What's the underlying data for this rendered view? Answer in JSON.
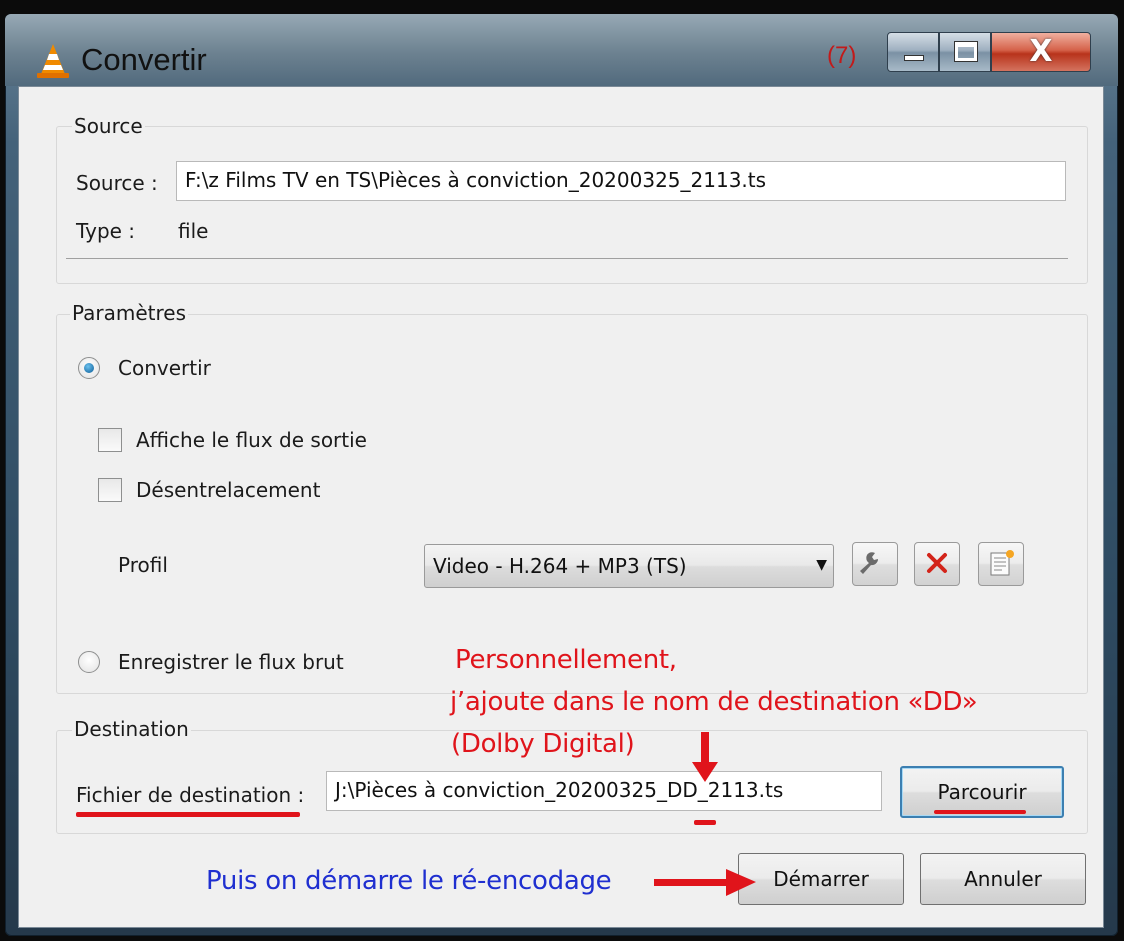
{
  "window": {
    "title": "Convertir",
    "step_annotation": "(7)",
    "close_glyph": "X"
  },
  "source_group": {
    "label": "Source",
    "source_label": "Source :",
    "source_value": "F:\\z  Films TV en TS\\Pièces à conviction_20200325_2113.ts",
    "type_label": "Type :",
    "type_value": "file"
  },
  "params_group": {
    "label": "Paramètres",
    "convert_label": "Convertir",
    "convert_selected": true,
    "show_output_label": "Affiche le flux de sortie",
    "show_output_checked": false,
    "deinterlace_label": "Désentrelacement",
    "deinterlace_checked": false,
    "profile_label": "Profil",
    "profile_value": "Video - H.264 + MP3 (TS)",
    "dump_raw_label": "Enregistrer le flux brut",
    "dump_raw_selected": false
  },
  "dest_group": {
    "label": "Destination",
    "file_label": "Fichier de destination :",
    "file_value": "J:\\Pièces à conviction_20200325_DD_2113.ts",
    "browse_label": "Parcourir"
  },
  "buttons": {
    "start_label": "Démarrer",
    "cancel_label": "Annuler"
  },
  "annotations": {
    "note_line1": "Personnellement,",
    "note_line2": "j’ajoute dans le nom de destination «DD»",
    "note_line3": "(Dolby Digital)",
    "start_hint": "Puis on démarre le ré-encodage",
    "red_color": "#e0141b",
    "blue_color": "#1f2fd0"
  }
}
